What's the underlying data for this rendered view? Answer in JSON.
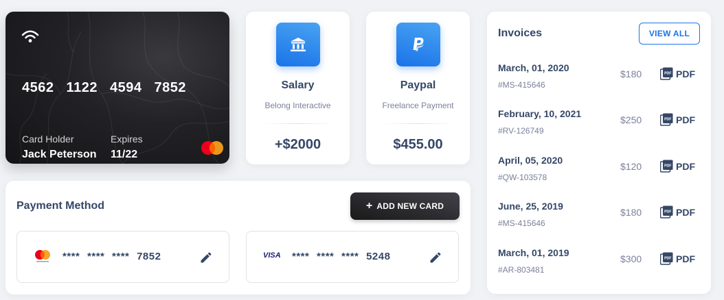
{
  "credit_card": {
    "number": "4562 1122 4594 7852",
    "holder_label": "Card Holder",
    "holder_name": "Jack Peterson",
    "expires_label": "Expires",
    "expires_value": "11/22",
    "icons": [
      "wifi-icon",
      "mastercard-logo"
    ]
  },
  "info_cards": [
    {
      "icon": "bank-icon",
      "title": "Salary",
      "subtitle": "Belong Interactive",
      "amount": "+$2000"
    },
    {
      "icon": "paypal-icon",
      "title": "Paypal",
      "subtitle": "Freelance Payment",
      "amount": "$455.00"
    }
  ],
  "payment_method": {
    "title": "Payment Method",
    "add_button": "ADD NEW CARD",
    "cards": [
      {
        "brand": "mastercard",
        "masked": "****  ****  ****",
        "last4": "7852"
      },
      {
        "brand": "visa",
        "brand_label": "VISA",
        "masked": "****  ****  ****",
        "last4": "5248"
      }
    ]
  },
  "invoices": {
    "title": "Invoices",
    "view_all": "VIEW ALL",
    "pdf_label": "PDF",
    "pdf_badge": "PDF",
    "items": [
      {
        "date": "March, 01, 2020",
        "id": "#MS-415646",
        "amount": "$180"
      },
      {
        "date": "February, 10, 2021",
        "id": "#RV-126749",
        "amount": "$250"
      },
      {
        "date": "April, 05, 2020",
        "id": "#QW-103578",
        "amount": "$120"
      },
      {
        "date": "June, 25, 2019",
        "id": "#MS-415646",
        "amount": "$180"
      },
      {
        "date": "March, 01, 2019",
        "id": "#AR-803481",
        "amount": "$300"
      }
    ]
  },
  "colors": {
    "background": "#f0f2f5",
    "accent_blue": "#1a73e8",
    "text_dark": "#344767",
    "text_muted": "#7b809a",
    "mastercard_red": "#eb001b",
    "mastercard_yellow": "#f79e1b",
    "visa_blue": "#1a1f71"
  }
}
